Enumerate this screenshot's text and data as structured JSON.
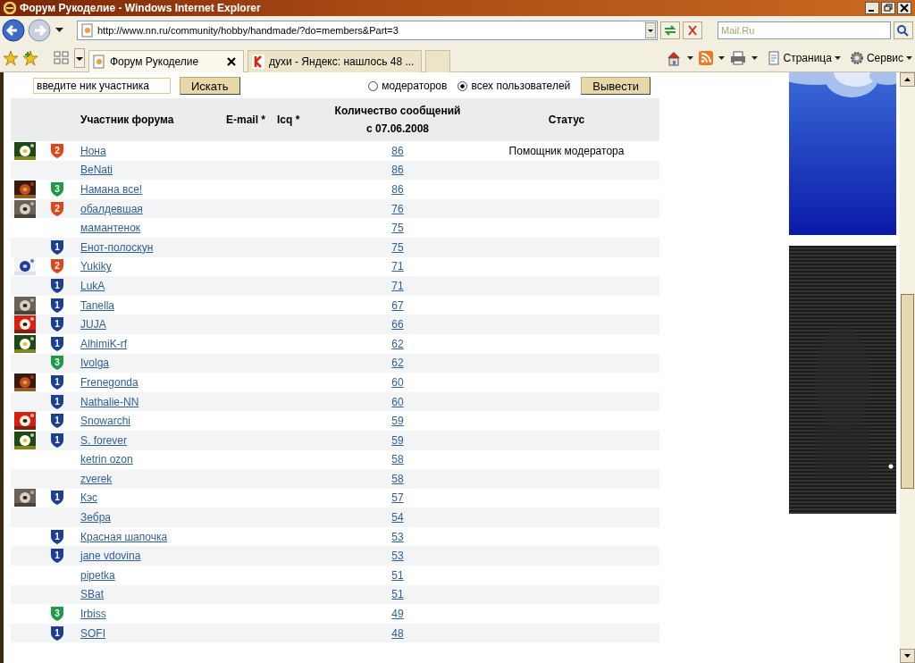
{
  "window": {
    "title": "Форум Рукоделие - Windows Internet Explorer"
  },
  "address": {
    "url": "http://www.nn.ru/community/hobby/handmade/?do=members&Part=3"
  },
  "web_search": {
    "placeholder": "Mail.Ru"
  },
  "tabs": [
    {
      "kind": "page",
      "label": "Форум Рукоделие",
      "selected": true
    },
    {
      "kind": "page",
      "label": "духи - Яндекс: нашлось 48 ...",
      "selected": false
    },
    {
      "kind": "new",
      "selected": false
    }
  ],
  "command_bar": [
    {
      "kind": "page",
      "label": "Страница"
    },
    {
      "kind": "tools",
      "label": "Сервис"
    }
  ],
  "member_search": {
    "value": "введите ник участника",
    "button": "Искать"
  },
  "filter": {
    "options": [
      {
        "label": "модераторов",
        "selected": false
      },
      {
        "label": "всех пользователей",
        "selected": true
      }
    ],
    "button": "Вывести"
  },
  "table": {
    "columns": [
      "Участник форума",
      "E-mail *",
      "Icq *",
      "Количество сообщений с 07.06.2008",
      "Статус"
    ],
    "rows": [
      {
        "name": "Нона",
        "posts": "86",
        "status": "Помощник модератора",
        "badge": {
          "rank": "2",
          "color": "#e0461c"
        }
      },
      {
        "name": "BeNati",
        "posts": "86"
      },
      {
        "name": "Намана все!",
        "posts": "86",
        "badge": {
          "rank": "3",
          "color": "#1f9a48"
        }
      },
      {
        "name": "обалдевшая",
        "posts": "76",
        "badge": {
          "rank": "2",
          "color": "#e0461c"
        }
      },
      {
        "name": "мамантенок",
        "posts": "75"
      },
      {
        "name": "Енот-полоскун",
        "posts": "75",
        "badge": {
          "rank": "1",
          "color": "#1c3f94"
        }
      },
      {
        "name": "Yukiky",
        "posts": "71",
        "badge": {
          "rank": "2",
          "color": "#e0461c"
        }
      },
      {
        "name": "LukA",
        "posts": "71",
        "badge": {
          "rank": "1",
          "color": "#1c3f94"
        }
      },
      {
        "name": "Tanella",
        "posts": "67",
        "badge": {
          "rank": "1",
          "color": "#1c3f94"
        }
      },
      {
        "name": "JUJA",
        "posts": "66",
        "badge": {
          "rank": "1",
          "color": "#1c3f94"
        }
      },
      {
        "name": "AlhimiK-rf",
        "posts": "62",
        "badge": {
          "rank": "1",
          "color": "#1c3f94"
        }
      },
      {
        "name": "Ivolga",
        "posts": "62",
        "badge": {
          "rank": "3",
          "color": "#1f9a48"
        }
      },
      {
        "name": "Frenegonda",
        "posts": "60",
        "badge": {
          "rank": "1",
          "color": "#1c3f94"
        }
      },
      {
        "name": "Nathalie-NN",
        "posts": "60",
        "badge": {
          "rank": "1",
          "color": "#1c3f94"
        }
      },
      {
        "name": "Snowarchi",
        "posts": "59",
        "badge": {
          "rank": "1",
          "color": "#1c3f94"
        }
      },
      {
        "name": "S. forever",
        "posts": "59",
        "badge": {
          "rank": "1",
          "color": "#1c3f94"
        }
      },
      {
        "name": "ketrin ozon",
        "posts": "58"
      },
      {
        "name": "zverek",
        "posts": "58"
      },
      {
        "name": "Кэс",
        "posts": "57",
        "badge": {
          "rank": "1",
          "color": "#1c3f94"
        }
      },
      {
        "name": "Зебра",
        "posts": "54"
      },
      {
        "name": "Красная шапочка",
        "posts": "53",
        "badge": {
          "rank": "1",
          "color": "#1c3f94"
        }
      },
      {
        "name": "jane vdovina",
        "posts": "53",
        "badge": {
          "rank": "1",
          "color": "#1c3f94"
        }
      },
      {
        "name": "pipetka",
        "posts": "51"
      },
      {
        "name": "SBat",
        "posts": "51"
      },
      {
        "name": "Irbiss",
        "posts": "49",
        "badge": {
          "rank": "3",
          "color": "#1f9a48"
        }
      },
      {
        "name": "SOFI",
        "posts": "48",
        "badge": {
          "rank": "1",
          "color": "#1c3f94"
        }
      }
    ]
  }
}
